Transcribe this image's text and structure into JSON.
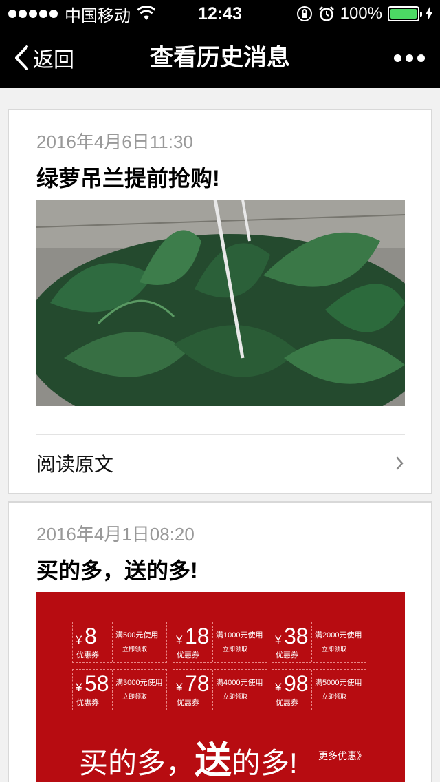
{
  "status_bar": {
    "carrier": "中国移动",
    "time": "12:43",
    "battery_percent": "100%",
    "battery_color": "#4cd964"
  },
  "nav": {
    "back_label": "返回",
    "title": "查看历史消息",
    "back_icon": "chevron-left-icon",
    "more_icon": "more-icon"
  },
  "messages": [
    {
      "date": "2016年4月6日11:30",
      "title": "绿萝吊兰提前抢购!",
      "image": "pothos-plant-photo",
      "read_more": "阅读原文"
    },
    {
      "date": "2016年4月1日08:20",
      "title": "买的多，送的多!",
      "image": "coupon-promo-banner",
      "promo": {
        "coupons": [
          {
            "yen": "¥",
            "amount": "8",
            "label": "优惠券",
            "condition": "满500元使用",
            "action": "立即领取"
          },
          {
            "yen": "¥",
            "amount": "18",
            "label": "优惠券",
            "condition": "满1000元使用",
            "action": "立即领取"
          },
          {
            "yen": "¥",
            "amount": "38",
            "label": "优惠券",
            "condition": "满2000元使用",
            "action": "立即领取"
          },
          {
            "yen": "¥",
            "amount": "58",
            "label": "优惠券",
            "condition": "满3000元使用",
            "action": "立即领取"
          },
          {
            "yen": "¥",
            "amount": "78",
            "label": "优惠券",
            "condition": "满4000元使用",
            "action": "立即领取"
          },
          {
            "yen": "¥",
            "amount": "98",
            "label": "优惠券",
            "condition": "满5000元使用",
            "action": "立即领取"
          }
        ],
        "slogan_part1": "买的多，",
        "slogan_big": "送",
        "slogan_part2": "的多!",
        "more_offers": "更多优惠》"
      }
    }
  ]
}
